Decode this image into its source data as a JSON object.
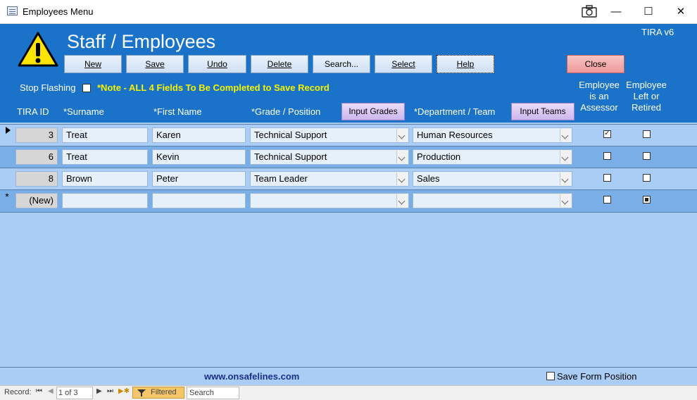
{
  "window": {
    "title": "Employees Menu",
    "minimize": "—",
    "maximize": "☐",
    "close": "✕",
    "camera": "⌽"
  },
  "header": {
    "title": "Staff / Employees",
    "version": "TIRA v6",
    "buttons": {
      "new": "New",
      "save": "Save",
      "undo": "Undo",
      "delete": "Delete",
      "search": "Search...",
      "select": "Select",
      "help": "Help",
      "close": "Close"
    },
    "stop_flashing": "Stop Flashing",
    "note": "*Note - ALL 4 Fields To Be Completed to Save Record"
  },
  "columns": {
    "tira_id": "TIRA ID",
    "surname": "*Surname",
    "first_name": "*First Name",
    "grade": "*Grade / Position",
    "input_grades": "Input Grades",
    "department": "*Department / Team",
    "input_teams": "Input Teams",
    "assessor": [
      "Employee",
      "is an",
      "Assessor"
    ],
    "left": [
      "Employee",
      "Left or",
      "Retired"
    ]
  },
  "rows": [
    {
      "id": "3",
      "surname": "Treat",
      "first": "Karen",
      "grade": "Technical Support",
      "dept": "Human Resources",
      "assessor": true,
      "left": false
    },
    {
      "id": "6",
      "surname": "Treat",
      "first": "Kevin",
      "grade": "Technical Support",
      "dept": "Production",
      "assessor": false,
      "left": false
    },
    {
      "id": "8",
      "surname": "Brown",
      "first": "Peter",
      "grade": "Team Leader",
      "dept": "Sales",
      "assessor": false,
      "left": false
    }
  ],
  "new_row": {
    "id": "(New)",
    "selector": "*"
  },
  "footer": {
    "website": "www.onsafelines.com",
    "save_position": "Save Form Position"
  },
  "navbar": {
    "record_label": "Record:",
    "position": "1 of 3",
    "filtered": "Filtered",
    "search": "Search"
  },
  "colors": {
    "header_blue": "#1a73c9",
    "body_blue": "#a9cdf5",
    "note_yellow": "#f6f200",
    "close_red": "#f2a0a0",
    "link_navy": "#1c2f8a"
  }
}
